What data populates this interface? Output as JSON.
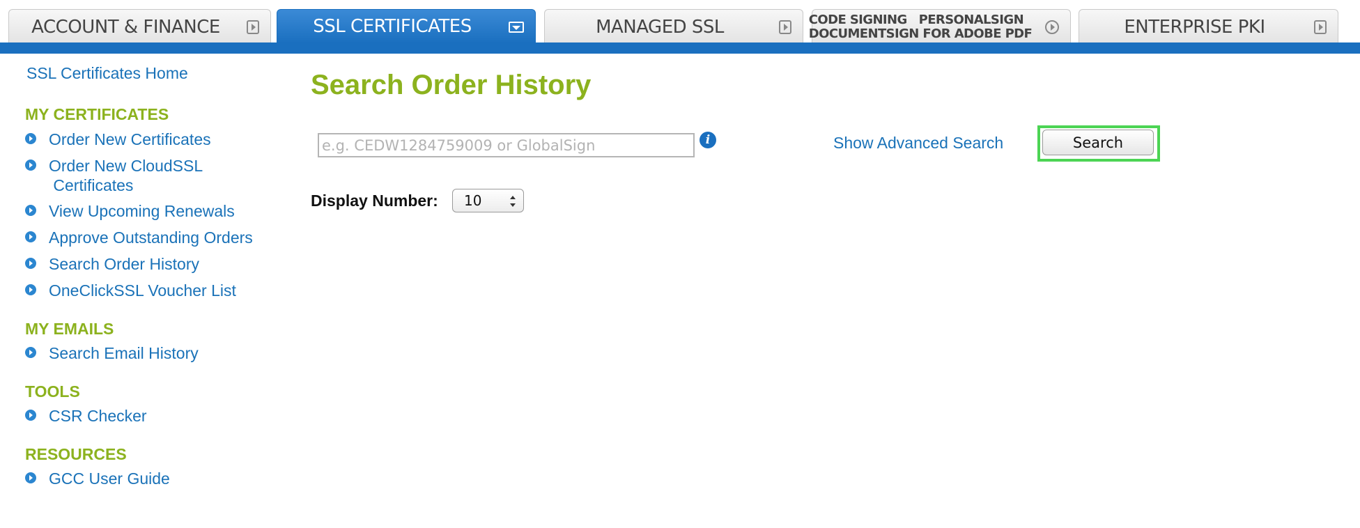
{
  "tabs": [
    {
      "label": "ACCOUNT & FINANCE",
      "active": false
    },
    {
      "label": "SSL CERTIFICATES",
      "active": true
    },
    {
      "label": "MANAGED SSL",
      "active": false
    },
    {
      "label_line1": "CODE SIGNING   PERSONALSIGN",
      "label_line2": "DOCUMENTSIGN FOR ADOBE PDF",
      "active": false
    },
    {
      "label": "ENTERPRISE PKI",
      "active": false
    }
  ],
  "sidebar": {
    "home": "SSL Certificates Home",
    "sections": [
      {
        "heading": "MY CERTIFICATES",
        "items": [
          "Order New Certificates",
          "Order New CloudSSL\n Certificates",
          "View Upcoming Renewals",
          "Approve Outstanding Orders",
          "Search Order History",
          "OneClickSSL Voucher List"
        ]
      },
      {
        "heading": "MY EMAILS",
        "items": [
          "Search Email History"
        ]
      },
      {
        "heading": "TOOLS",
        "items": [
          "CSR Checker"
        ]
      },
      {
        "heading": "RESOURCES",
        "items": [
          "GCC User Guide"
        ]
      }
    ]
  },
  "main": {
    "title": "Search Order History",
    "search_placeholder": "e.g. CEDW1284759009 or GlobalSign",
    "search_value": "",
    "info_icon": "i",
    "advanced_link": "Show Advanced Search",
    "search_button": "Search",
    "display_label": "Display Number:",
    "display_value": "10"
  },
  "colors": {
    "brand_blue": "#1a6fbf",
    "heading_green": "#8cb21e",
    "link_blue": "#1a72b8",
    "highlight_green": "#4cd454"
  }
}
